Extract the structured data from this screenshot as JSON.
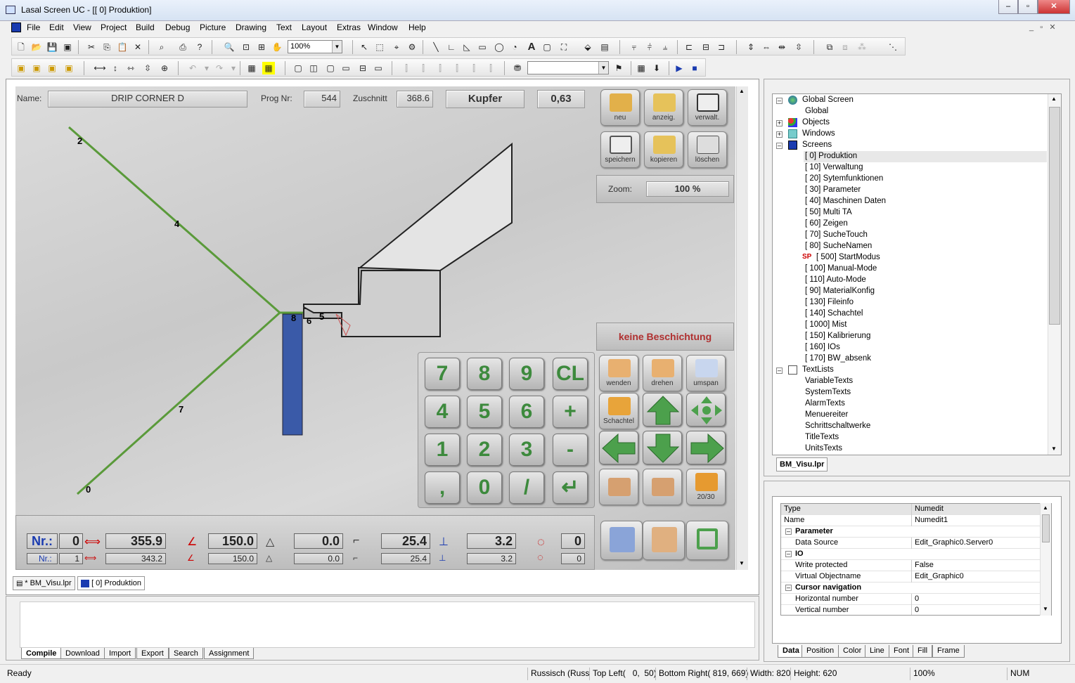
{
  "window": {
    "title": "Lasal Screen UC - [[ 0] Produktion]"
  },
  "menu": [
    "File",
    "Edit",
    "View",
    "Project",
    "Build",
    "Debug",
    "Picture",
    "Drawing",
    "Text",
    "Layout",
    "Extras",
    "Window",
    "Help"
  ],
  "toolbar": {
    "zoom": "100%",
    "style_combo": ""
  },
  "screen": {
    "name_label": "Name:",
    "name_value": "DRIP CORNER D",
    "prog_label": "Prog Nr:",
    "prog_value": "544",
    "zuschnitt_label": "Zuschnitt",
    "zuschnitt_value": "368.6",
    "material": "Kupfer",
    "thickness": "0,63",
    "zoom_label": "Zoom:",
    "zoom_value": "100 %",
    "coating": "keine Beschichtung",
    "segments": [
      "2",
      "4",
      "8",
      "6",
      "5",
      "7",
      "0"
    ],
    "top_buttons": [
      "neu",
      "anzeig.",
      "verwalt.",
      "speichern",
      "kopieren",
      "löschen"
    ],
    "action_buttons": [
      "wenden",
      "drehen",
      "umspan",
      "Schachtel",
      "",
      "",
      "",
      "",
      "20/30"
    ],
    "keypad": [
      "7",
      "8",
      "9",
      "CL",
      "4",
      "5",
      "6",
      "+",
      "1",
      "2",
      "3",
      "-",
      ",",
      "0",
      "/",
      "↵"
    ],
    "row1": {
      "nr_label": "Nr.:",
      "nr": "0",
      "length": "355.9",
      "angle": "150.0",
      "angle2": "0.0",
      "v1": "25.4",
      "v2": "3.2",
      "v3": "0"
    },
    "row2": {
      "nr_label": "Nr.:",
      "nr": "1",
      "length": "343.2",
      "angle": "150.0",
      "angle2": "0.0",
      "v1": "25.4",
      "v2": "3.2",
      "v3": "0"
    }
  },
  "doc_tabs": [
    "* BM_Visu.lpr",
    "[ 0] Produktion"
  ],
  "output_tabs": [
    "Compile",
    "Download",
    "Import",
    "Export",
    "Search",
    "Assignment"
  ],
  "tree": {
    "global_screen": "Global Screen",
    "global": "Global",
    "objects": "Objects",
    "windows": "Windows",
    "screens": "Screens",
    "screen_items": [
      "[   0] Produktion",
      "[   10] Verwaltung",
      "[   20] Sytemfunktionen",
      "[   30] Parameter",
      "[   40] Maschinen Daten",
      "[   50] Multi TA",
      "[   60] Zeigen",
      "[   70] SucheTouch",
      "[   80] SucheNamen",
      "[  500] StartModus",
      "[  100] Manual-Mode",
      "[  110] Auto-Mode",
      "[   90] MaterialKonfig",
      "[  130] Fileinfo",
      "[  140] Schachtel",
      "[ 1000] Mist",
      "[  150] Kalibrierung",
      "[  160] IOs",
      "[  170] BW_absenk"
    ],
    "sp_badge": "SP",
    "textlists": "TextLists",
    "textlist_items": [
      "VariableTexts",
      "SystemTexts",
      "AlarmTexts",
      "Menuereiter",
      "Schrittschaltwerke",
      "TitleTexts",
      "UnitsTexts"
    ],
    "project_tab": "BM_Visu.lpr"
  },
  "properties": {
    "rows": [
      {
        "k": "Type",
        "v": "Numedit",
        "hdr": false,
        "sel": true
      },
      {
        "k": "Name",
        "v": "Numedit1",
        "hdr": false
      },
      {
        "k": "Parameter",
        "v": "",
        "hdr": true
      },
      {
        "k": "Data Source",
        "v": "Edit_Graphic0.Server0",
        "hdr": false,
        "indent": true
      },
      {
        "k": "IO",
        "v": "",
        "hdr": true
      },
      {
        "k": "Write protected",
        "v": "False",
        "hdr": false,
        "indent": true
      },
      {
        "k": "Virtual Objectname",
        "v": "Edit_Graphic0",
        "hdr": false,
        "indent": true
      },
      {
        "k": "Cursor navigation",
        "v": "",
        "hdr": true
      },
      {
        "k": "Horizontal number",
        "v": "0",
        "hdr": false,
        "indent": true
      },
      {
        "k": "Vertical number",
        "v": "0",
        "hdr": false,
        "indent": true
      }
    ],
    "tabs": [
      "Data",
      "Position",
      "Color",
      "Line",
      "Font",
      "Fill",
      "Frame"
    ]
  },
  "status": {
    "ready": "Ready",
    "lang": "Russisch (Russis",
    "topleft": "Top Left(   0,  50)",
    "bottomright": "Bottom Right( 819, 669)",
    "width": "Width: 820",
    "height": "Height: 620",
    "zoom": "100%",
    "num": "NUM"
  },
  "colors": {
    "accent_green": "#5a9a3a",
    "blue_bar": "#3a5aa8",
    "coating_red": "#b03030"
  }
}
